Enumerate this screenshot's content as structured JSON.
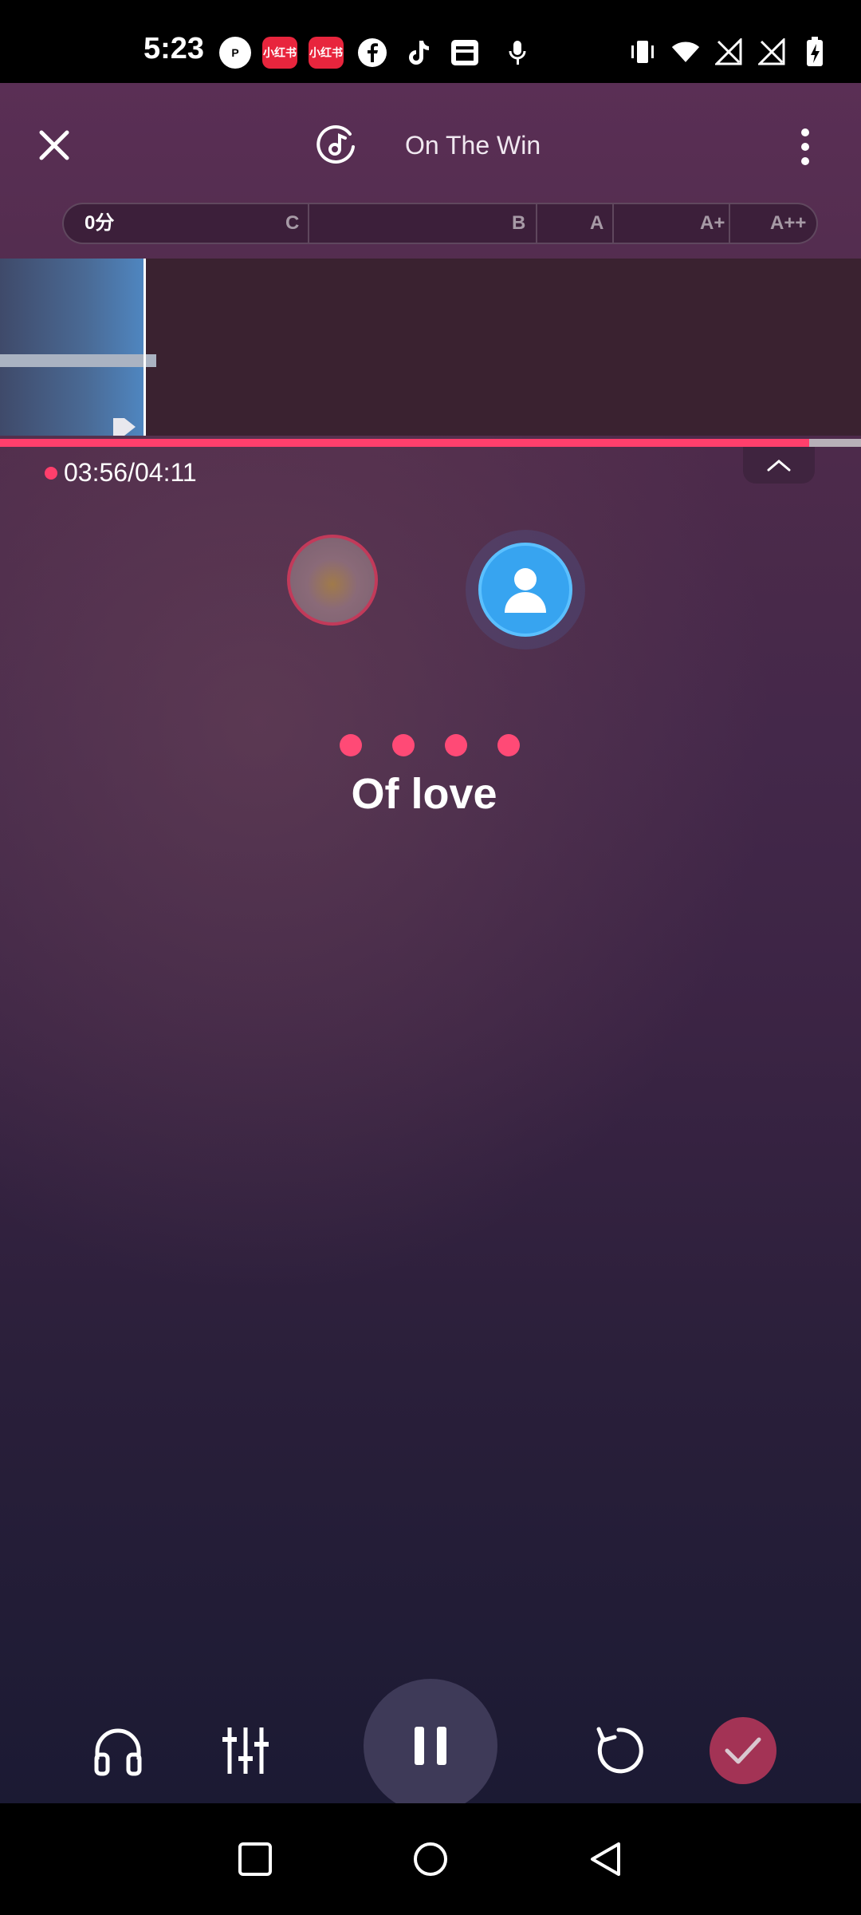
{
  "status_bar": {
    "time": "5:23",
    "left_icons": [
      "p-icon",
      "xiaohongshu-icon",
      "xiaohongshu-icon",
      "facebook-icon",
      "tiktok-icon",
      "inbox-icon",
      "mic-icon"
    ],
    "xhs_label": "小红书",
    "right_icons": [
      "vibrate-icon",
      "wifi-icon",
      "signal-icon",
      "signal-icon",
      "battery-charging-icon"
    ]
  },
  "header": {
    "song_title": "On The Win"
  },
  "score_bar": {
    "score": "0分",
    "grades": [
      "C",
      "B",
      "A",
      "A+",
      "A++"
    ]
  },
  "playback": {
    "time": "03:56/04:11",
    "progress": 0.94
  },
  "lyric": "Of love",
  "colors": {
    "accent": "#ff3f6c",
    "partner_avatar": "#37a4f0",
    "done_button": "#a33355"
  },
  "controls": [
    "headphones-icon",
    "equalizer-icon",
    "pause-icon",
    "restart-icon",
    "check-icon"
  ],
  "nav": [
    "recents-icon",
    "home-icon",
    "back-icon"
  ]
}
